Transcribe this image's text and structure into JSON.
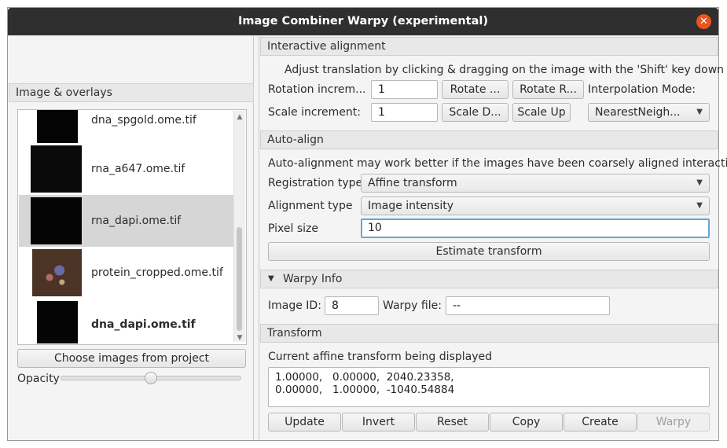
{
  "window": {
    "title": "Image Combiner Warpy (experimental)"
  },
  "left": {
    "header": "Image & overlays",
    "images": [
      {
        "name": "dna_spgold.ome.tif",
        "selected": false,
        "bold": false,
        "thumb": "dark"
      },
      {
        "name": "rna_a647.ome.tif",
        "selected": false,
        "bold": false,
        "thumb": "dark"
      },
      {
        "name": "rna_dapi.ome.tif",
        "selected": true,
        "bold": false,
        "thumb": "dark"
      },
      {
        "name": "protein_cropped.ome.tif",
        "selected": false,
        "bold": false,
        "thumb": "protein"
      },
      {
        "name": "dna_dapi.ome.tif",
        "selected": false,
        "bold": true,
        "thumb": "dark"
      }
    ],
    "choose_button": "Choose images from project",
    "opacity_label": "Opacity",
    "opacity_value": 0.5
  },
  "interactive": {
    "header": "Interactive alignment",
    "instruction": "Adjust translation by clicking & dragging on the image with the 'Shift' key down",
    "rotation_label": "Rotation increm...",
    "rotation_value": "1",
    "rotate_left": "Rotate ...",
    "rotate_right": "Rotate R...",
    "interpolation_label": "Interpolation Mode:",
    "scale_label": "Scale increment:",
    "scale_value": "1",
    "scale_down": "Scale D...",
    "scale_up": "Scale Up",
    "interpolation_value": "NearestNeigh..."
  },
  "autoalign": {
    "header": "Auto-align",
    "note": "Auto-alignment may work better if the images have been coarsely aligned interacti...",
    "registration_label": "Registration type",
    "registration_value": "Affine transform",
    "alignment_label": "Alignment type",
    "alignment_value": "Image intensity",
    "pixel_label": "Pixel size",
    "pixel_value": "10",
    "estimate_button": "Estimate transform"
  },
  "warpy": {
    "header": "Warpy Info",
    "image_id_label": "Image ID:",
    "image_id_value": "8",
    "file_label": "Warpy file:",
    "file_value": "--"
  },
  "transform": {
    "header": "Transform",
    "caption": "Current affine transform being displayed",
    "line1": "1.00000,   0.00000,  2040.23358,",
    "line2": "0.00000,   1.00000,  -1040.54884",
    "buttons": {
      "update": "Update",
      "invert": "Invert",
      "reset": "Reset",
      "copy": "Copy",
      "create": "Create",
      "warpy": "Warpy"
    }
  },
  "colors": {
    "titlebar": "#2f2f2f",
    "close": "#e95420",
    "focus": "#5fa8d8",
    "selection": "#d6d6d6"
  }
}
